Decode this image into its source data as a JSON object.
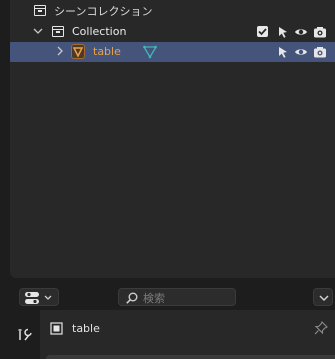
{
  "outliner": {
    "scene_collection_label": "シーンコレクション",
    "collection_label": "Collection",
    "object_label": "table"
  },
  "header": {
    "search_placeholder": "検索"
  },
  "properties": {
    "object_name": "table"
  },
  "colors": {
    "selected_row": "#44547a",
    "object_text": "#e8a24a",
    "mesh_data": "#3fb8b8"
  },
  "icons": {
    "scene": "scene-collection-icon",
    "collection": "collection-icon",
    "object": "mesh-object-icon",
    "mesh_data": "mesh-data-icon",
    "exclude_checkbox": "checkbox-icon",
    "selectable": "cursor-icon",
    "visibility": "eye-icon",
    "render": "camera-icon"
  }
}
